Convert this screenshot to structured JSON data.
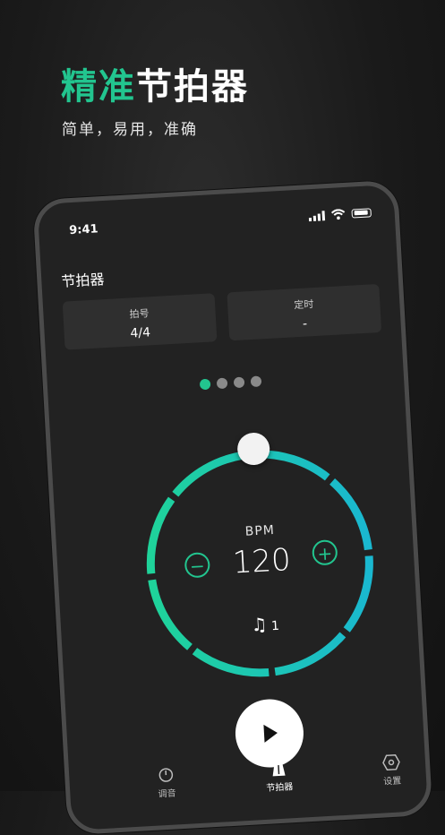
{
  "hero": {
    "title_accent": "精准",
    "title_rest": "节拍器",
    "subtitle": "简单，易用，准确"
  },
  "status_bar": {
    "time": "9:41"
  },
  "screen": {
    "title": "节拍器",
    "cards": [
      {
        "label": "拍号",
        "value": "4/4"
      },
      {
        "label": "定时",
        "value": "-"
      }
    ],
    "page_dots": {
      "count": 4,
      "active_index": 0
    }
  },
  "dial": {
    "label": "BPM",
    "value": "120",
    "minus": "−",
    "plus": "+",
    "beat_count": "1",
    "note_icon": "music-note-icon"
  },
  "tabs": [
    {
      "label": "调音",
      "icon": "tuner-icon"
    },
    {
      "label": "节拍器",
      "icon": "metronome-icon"
    },
    {
      "label": "设置",
      "icon": "settings-hex-icon"
    }
  ],
  "colors": {
    "accent": "#22c58f",
    "ring_start": "#1fd39a",
    "ring_end": "#1ab8d0",
    "background": "#1a1a1a",
    "phone_screen": "#222222"
  }
}
